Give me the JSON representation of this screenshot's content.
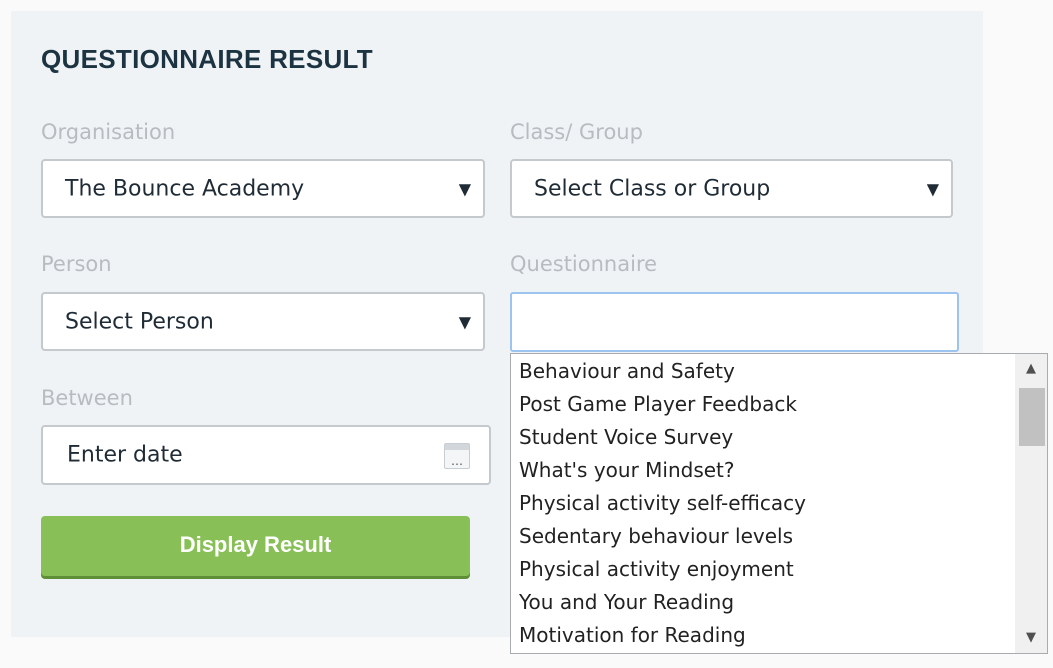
{
  "form": {
    "title": "QUESTIONNAIRE RESULT",
    "organisation": {
      "label": "Organisation",
      "value": "The Bounce Academy"
    },
    "class_group": {
      "label": "Class/ Group",
      "value": "Select Class or Group"
    },
    "person": {
      "label": "Person",
      "value": "Select Person"
    },
    "questionnaire": {
      "label": "Questionnaire",
      "value": ""
    },
    "between": {
      "label": "Between",
      "placeholder": "Enter date"
    },
    "submit_label": "Display Result",
    "caret_glyph": "▼",
    "calendar_glyph": "…"
  },
  "questionnaire_options": [
    "Behaviour and Safety",
    "Post Game Player Feedback",
    "Student Voice Survey",
    "What's your Mindset?",
    "Physical activity self-efficacy",
    "Sedentary behaviour levels",
    "Physical activity enjoyment",
    "You and Your Reading",
    "Motivation for Reading"
  ],
  "colors": {
    "accent_button": "#88c057",
    "focus_border": "#9dc3ef",
    "title": "#1c3341"
  }
}
